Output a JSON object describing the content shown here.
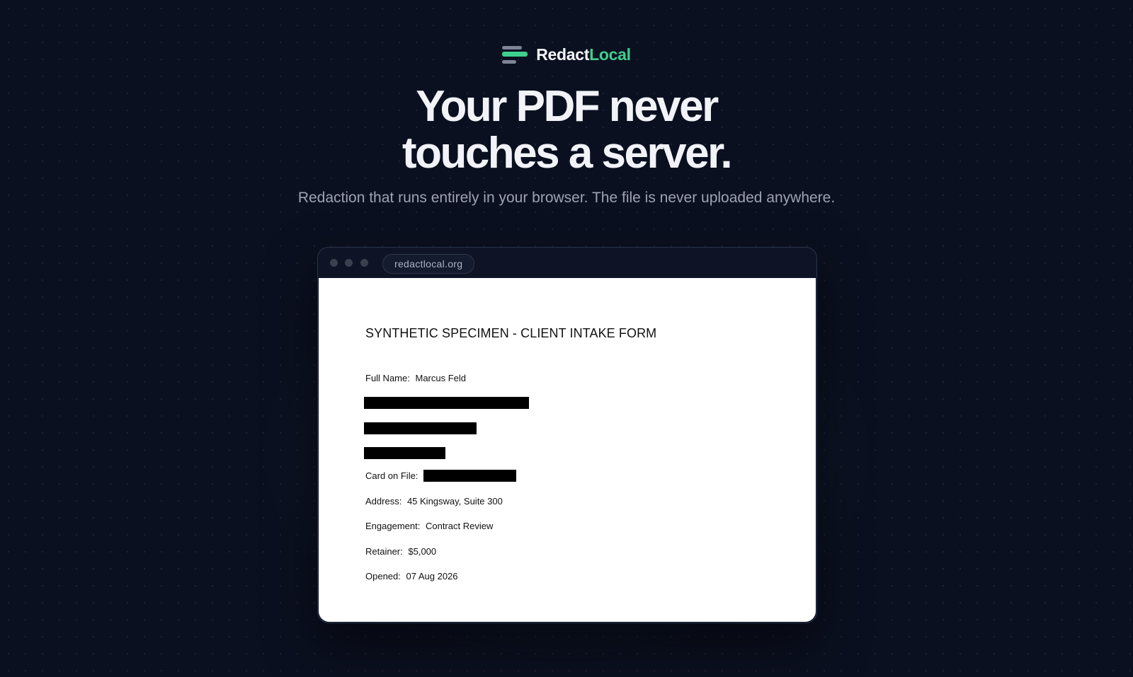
{
  "brand": {
    "name_primary": "Redact",
    "name_accent": "Local",
    "icon": "redaction-lines-logo",
    "accent_color": "#3ecf8e"
  },
  "hero": {
    "headline_line1": "Your PDF never",
    "headline_line2": "touches a server.",
    "subheadline": "Redaction that runs entirely in your browser. The file is never uploaded anywhere."
  },
  "browser": {
    "url": "redactlocal.org"
  },
  "document": {
    "title": "SYNTHETIC SPECIMEN - CLIENT INTAKE FORM",
    "fields": {
      "full_name_label": "Full Name:",
      "full_name_value": "Marcus Feld",
      "card_label": "Card on File:",
      "address_label": "Address:",
      "address_value": "45 Kingsway, Suite 300",
      "engagement_label": "Engagement:",
      "engagement_value": "Contract Review",
      "retainer_label": "Retainer:",
      "retainer_value": "$5,000",
      "opened_label": "Opened:",
      "opened_value": "07 Aug 2026"
    },
    "redaction_color": "#000000"
  }
}
